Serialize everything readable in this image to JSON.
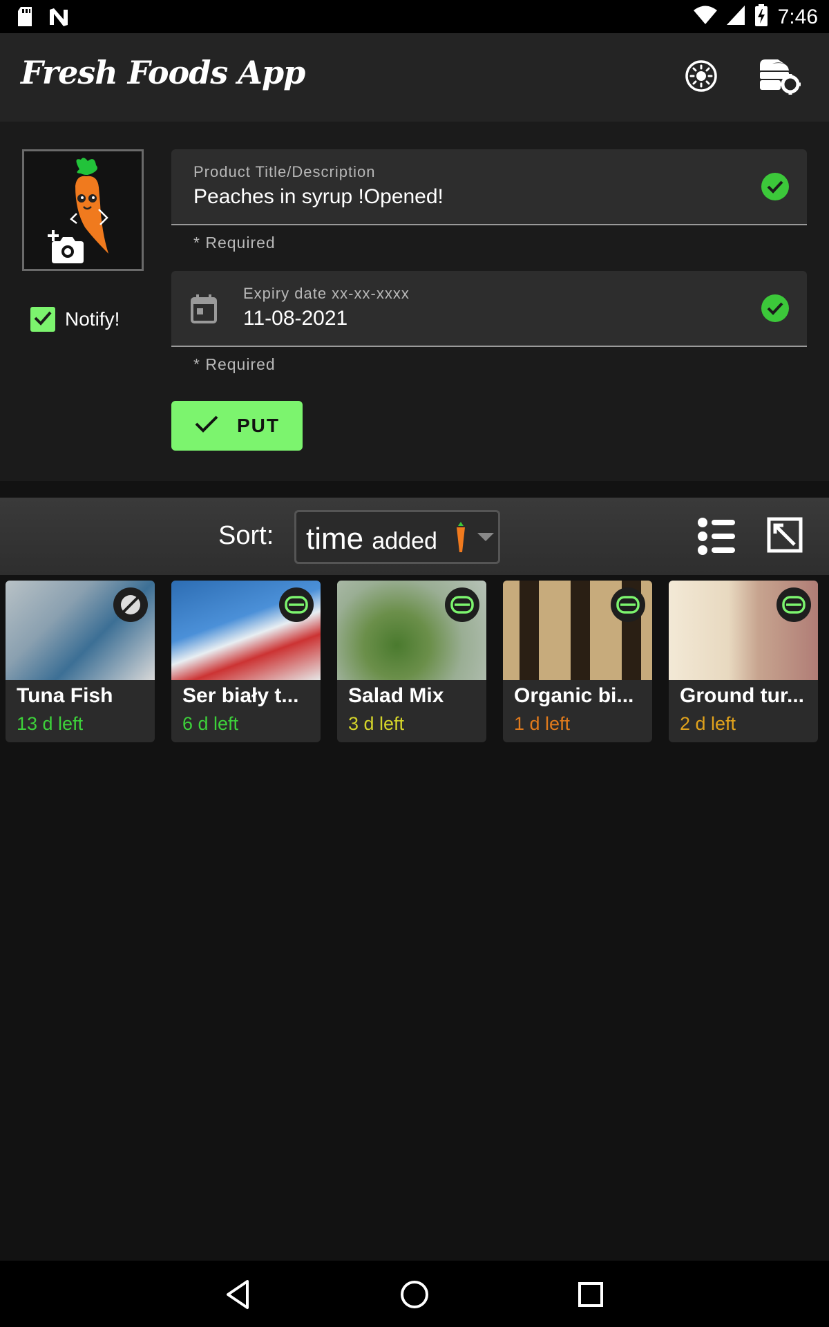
{
  "status_bar": {
    "time": "7:46"
  },
  "app_bar": {
    "title": "Fresh Foods App"
  },
  "form": {
    "notify_label": "Notify!",
    "title_field": {
      "label": "Product Title/Description",
      "value": "Peaches in syrup !Opened!"
    },
    "title_helper": "* Required",
    "date_field": {
      "label": "Expiry date xx-xx-xxxx",
      "value": "11-08-2021"
    },
    "date_helper": "* Required",
    "put_label": "PUT"
  },
  "sort": {
    "label": "Sort:",
    "value_main": "time",
    "value_small": "added"
  },
  "products": [
    {
      "name": "Tuna Fish",
      "left": "13 d left",
      "color": "#3dd13a",
      "badge": "no-food-icon"
    },
    {
      "name": "Ser biały t...",
      "left": "6 d left",
      "color": "#3dd13a",
      "badge": "fridge-icon"
    },
    {
      "name": "Salad Mix",
      "left": "3 d left",
      "color": "#d4d42a",
      "badge": "fridge-icon"
    },
    {
      "name": "Organic bi...",
      "left": "1 d left",
      "color": "#e07a1c",
      "badge": "fridge-icon"
    },
    {
      "name": "Ground tur...",
      "left": "2 d left",
      "color": "#e0a21c",
      "badge": "fridge-icon"
    }
  ],
  "colors": {
    "accent": "#7cf46e",
    "valid": "#3cc83a"
  }
}
